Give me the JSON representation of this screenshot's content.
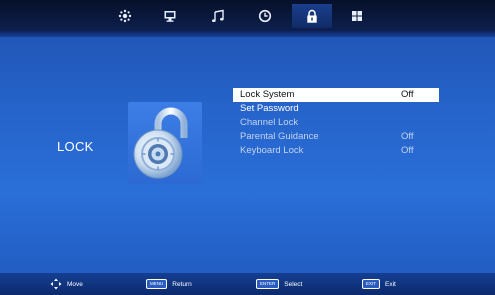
{
  "top_tabs": [
    {
      "icon": "picture-icon"
    },
    {
      "icon": "screen-icon"
    },
    {
      "icon": "music-note-icon"
    },
    {
      "icon": "clock-icon"
    },
    {
      "icon": "lock-icon",
      "active": true
    },
    {
      "icon": "grid-icon"
    }
  ],
  "section": {
    "title": "LOCK",
    "art_icon": "padlock-dial-icon"
  },
  "menu": [
    {
      "label": "Lock System",
      "value": "Off",
      "selected": true
    },
    {
      "label": "Set Password",
      "value": ""
    },
    {
      "label": "Channel Lock",
      "value": "",
      "disabled": true
    },
    {
      "label": "Parental Guidance",
      "value": "Off",
      "disabled": true
    },
    {
      "label": "Keyboard Lock",
      "value": "Off",
      "disabled": true
    }
  ],
  "footer": {
    "move": {
      "icon": "arrows-icon",
      "label": "Move"
    },
    "menu": {
      "key": "MENU",
      "label": "Return"
    },
    "enter": {
      "key": "ENTER",
      "label": "Select"
    },
    "exit": {
      "key": "EXIT",
      "label": "Exit"
    }
  },
  "colors": {
    "background": "#2563c9",
    "selected_row": "#ffffff",
    "topbar": "#0d1f4d"
  }
}
